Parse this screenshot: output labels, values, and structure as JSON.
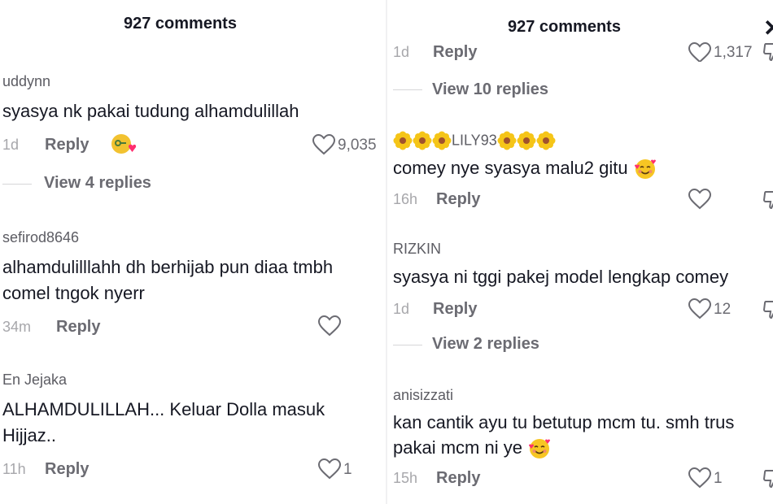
{
  "left": {
    "header": "927 comments",
    "comments": [
      {
        "username": "uddynn",
        "text": "syasya nk pakai tudung alhamdulillah",
        "time": "1d",
        "reply": "Reply",
        "likes": "9,035",
        "view_replies": "View 4 replies"
      },
      {
        "username": "sefirod8646",
        "text_line1": "alhamdulilllahh dh berhijab pun diaa tmbh",
        "text_line2": "comel tngok nyerr",
        "time": "34m",
        "reply": "Reply",
        "likes": ""
      },
      {
        "username": "En Jejaka",
        "text_line1": "ALHAMDULILLAH... Keluar Dolla masuk",
        "text_line2": "Hijjaz..",
        "time": "11h",
        "reply": "Reply",
        "likes": "1"
      }
    ]
  },
  "right": {
    "header": "927 comments",
    "partial": {
      "time": "1d",
      "reply": "Reply",
      "likes": "1,317"
    },
    "view_replies_top": "View 10 replies",
    "comments": [
      {
        "username": "LILY93",
        "text": "comey nye syasya malu2 gitu",
        "time": "16h",
        "reply": "Reply",
        "likes": ""
      },
      {
        "username": "RIZKIN",
        "text": "syasya ni tggi pakej model lengkap comey",
        "time": "1d",
        "reply": "Reply",
        "likes": "12",
        "view_replies": "View 2 replies"
      },
      {
        "username": "anisizzati",
        "text_line1": "kan cantik ayu tu betutup mcm tu. smh trus",
        "text_line2": "pakai mcm ni ye",
        "time": "15h",
        "reply": "Reply",
        "likes": "1"
      }
    ]
  },
  "icons": {
    "heart": "heart-outline-icon",
    "dislike": "thumbs-down-icon",
    "close": "close-icon",
    "smiling-face-with-hearts": "smiling-face-with-hearts-emoji",
    "flower": "blossom-emoji",
    "sticker": "key-heart-sticker"
  }
}
